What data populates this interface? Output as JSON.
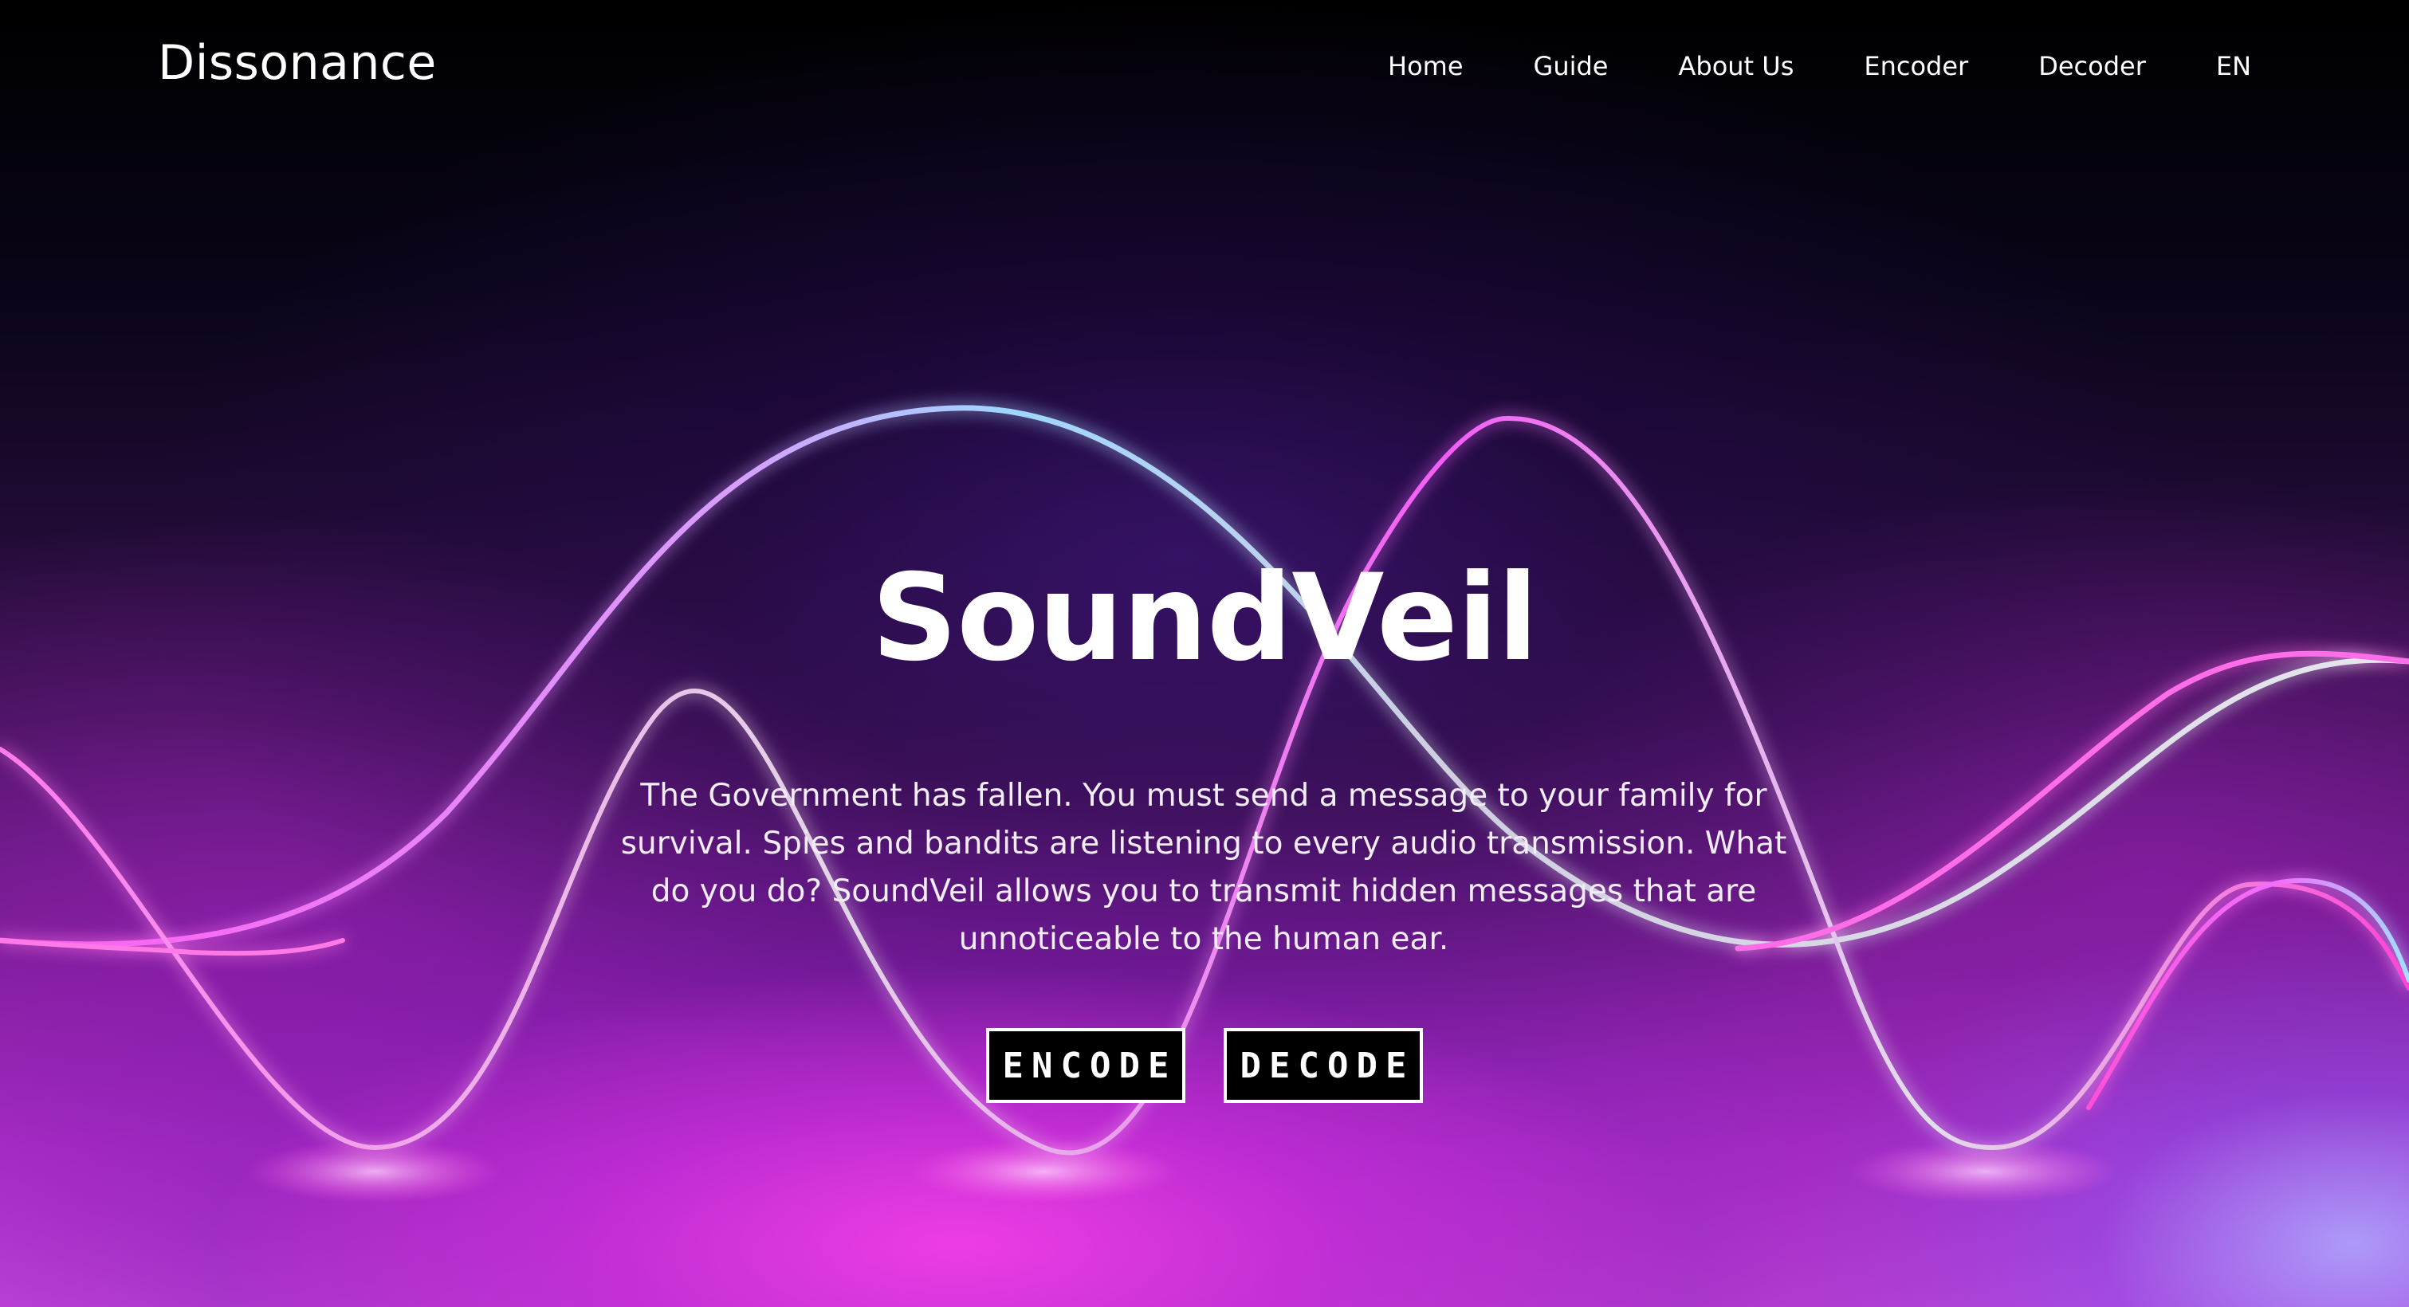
{
  "nav": {
    "brand": "Dissonance",
    "links": [
      "Home",
      "Guide",
      "About Us",
      "Encoder",
      "Decoder",
      "EN"
    ]
  },
  "hero": {
    "title": "SoundVeil",
    "description": "The Government has fallen. You must send a message to your family for survival. Spies and bandits are listening to every audio transmission. What do you do? SoundVeil allows you to transmit hidden messages that are unnoticeable to the human ear.",
    "buttons": {
      "encode": "ENCODE",
      "decode": "DECODE"
    }
  },
  "colors": {
    "wave_pink": "#ff4fd8",
    "wave_blue": "#8ad8ff",
    "background_dark": "#000000",
    "button_bg": "#000000",
    "button_border": "#ffffff"
  }
}
